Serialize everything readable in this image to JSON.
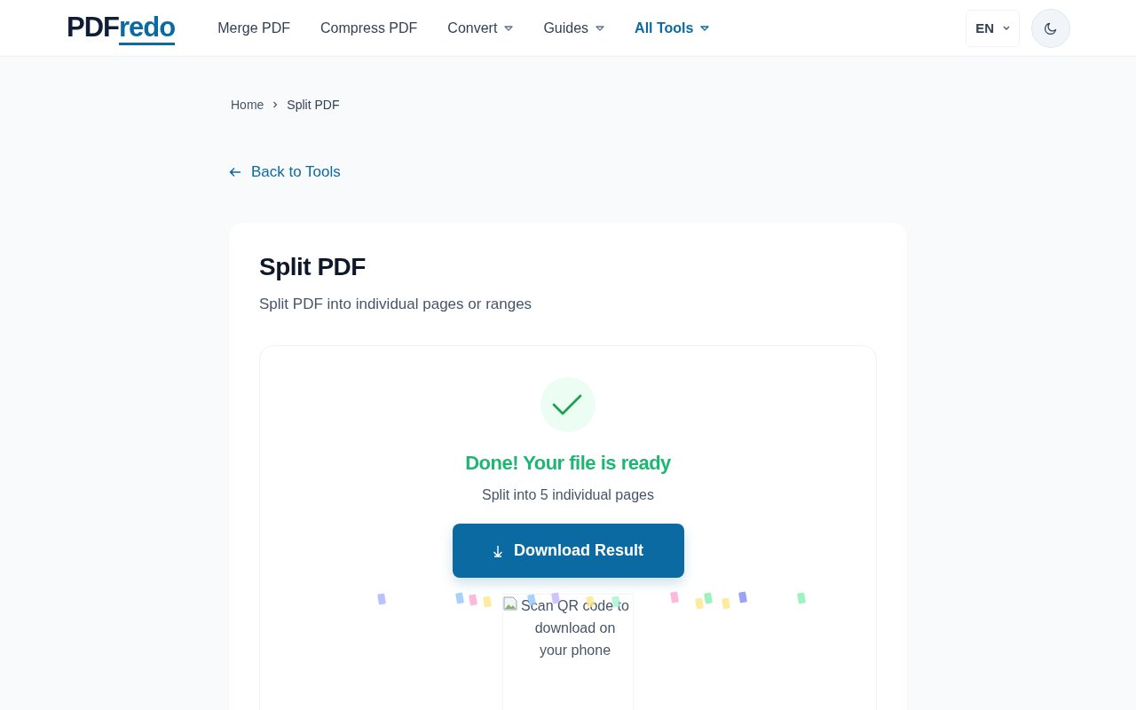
{
  "logo": {
    "first": "PDF",
    "second": "redo"
  },
  "nav": [
    {
      "label": "Merge PDF",
      "dropdown": false,
      "selected": false
    },
    {
      "label": "Compress PDF",
      "dropdown": false,
      "selected": false
    },
    {
      "label": "Convert",
      "dropdown": true,
      "selected": false
    },
    {
      "label": "Guides",
      "dropdown": true,
      "selected": false
    },
    {
      "label": "All Tools",
      "dropdown": true,
      "selected": true
    }
  ],
  "language": "EN",
  "breadcrumb": [
    "Home",
    "Split PDF"
  ],
  "back_link": "Back to Tools",
  "tool": {
    "title": "Split PDF",
    "subtitle": "Split PDF into individual pages or ranges"
  },
  "result": {
    "heading": "Done! Your file is ready",
    "detail": "Split into 5 individual pages",
    "button": "Download Result",
    "qr_alt": "Scan QR code to download on your phone"
  }
}
